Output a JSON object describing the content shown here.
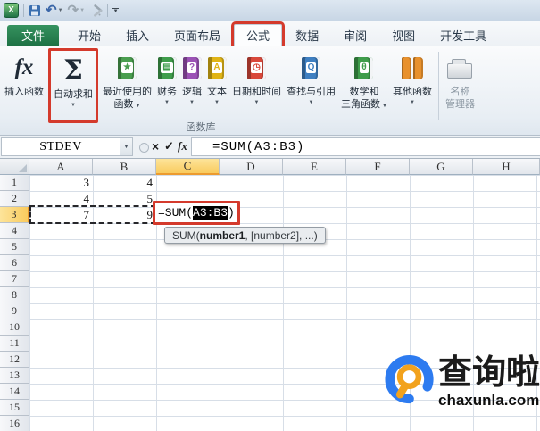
{
  "qat": {
    "icons": [
      "excel-logo",
      "save",
      "undo",
      "redo",
      "tools",
      "customize-quick-access-toolbar"
    ]
  },
  "tabs": {
    "file": {
      "id": "file",
      "label": "文件"
    },
    "items": [
      {
        "id": "home",
        "label": "开始"
      },
      {
        "id": "insert",
        "label": "插入"
      },
      {
        "id": "page-layout",
        "label": "页面布局"
      },
      {
        "id": "formulas",
        "label": "公式",
        "active": true,
        "annotated": true
      },
      {
        "id": "data",
        "label": "数据"
      },
      {
        "id": "review",
        "label": "审阅"
      },
      {
        "id": "view",
        "label": "视图"
      },
      {
        "id": "developer",
        "label": "开发工具"
      }
    ]
  },
  "ribbon": {
    "group_label": "函数库",
    "buttons": [
      {
        "id": "insert-function",
        "label_lines": [
          "插入函数"
        ],
        "icon": "fx",
        "has_caret": false
      },
      {
        "id": "autosum",
        "label_lines": [
          "自动求和"
        ],
        "icon": "sigma",
        "has_caret": true,
        "boxed": true
      },
      {
        "id": "recently-used-functions",
        "label_lines": [
          "最近使用的",
          "函数"
        ],
        "icon": "book",
        "glyph": "★",
        "color": "#4a9e4f",
        "has_caret": true
      },
      {
        "id": "financial",
        "label_lines": [
          "财务"
        ],
        "icon": "book",
        "glyph": "▤",
        "color": "#3f9d4b",
        "has_caret": true
      },
      {
        "id": "logical",
        "label_lines": [
          "逻辑"
        ],
        "icon": "book",
        "glyph": "?",
        "color": "#9b52b5",
        "has_caret": true
      },
      {
        "id": "text",
        "label_lines": [
          "文本"
        ],
        "icon": "book",
        "glyph": "A",
        "color": "#e0b416",
        "has_caret": true
      },
      {
        "id": "date-time",
        "label_lines": [
          "日期和时间"
        ],
        "icon": "book",
        "glyph": "◷",
        "color": "#d9483b",
        "has_caret": true
      },
      {
        "id": "lookup-reference",
        "label_lines": [
          "查找与引用"
        ],
        "icon": "book",
        "glyph": "Q",
        "color": "#3e7fc1",
        "has_caret": true
      },
      {
        "id": "math-trig",
        "label_lines": [
          "数学和",
          "三角函数"
        ],
        "icon": "book",
        "glyph": "θ",
        "color": "#3f9d4b",
        "has_caret": true
      },
      {
        "id": "more-functions",
        "label_lines": [
          "其他函数"
        ],
        "icon": "books",
        "color": "#e8912d",
        "has_caret": true
      },
      {
        "separator": true
      },
      {
        "id": "name-manager",
        "label_lines": [
          "名称",
          "管理器"
        ],
        "icon": "drawer",
        "has_caret": false,
        "disabled": true
      }
    ]
  },
  "formula_bar": {
    "name_box_value": "STDEV",
    "formula": "=SUM(A3:B3)"
  },
  "grid": {
    "columns": [
      "A",
      "B",
      "C",
      "D",
      "E",
      "F",
      "G",
      "H"
    ],
    "row_count": 16,
    "selected_column": "C",
    "selected_row": 3,
    "cells": [
      {
        "ref": "A1",
        "value": "3"
      },
      {
        "ref": "B1",
        "value": "4"
      },
      {
        "ref": "A2",
        "value": "4"
      },
      {
        "ref": "B2",
        "value": "5"
      },
      {
        "ref": "A3",
        "value": "7"
      },
      {
        "ref": "B3",
        "value": "9"
      }
    ],
    "edit_cell": {
      "ref": "C3",
      "prefix": "=SUM(",
      "selected_text": "A3:B3",
      "suffix": ")"
    },
    "tooltip": {
      "prefix": "SUM(",
      "bold": "number1",
      "suffix": ", [number2], ...)"
    }
  },
  "watermark": {
    "title": "查询啦",
    "domain": "chaxunla.com"
  },
  "colors": {
    "annotation_red": "#d43a2c",
    "selected_header_fill": "#f9cb5e",
    "file_tab_green": "#1f7245",
    "file_tab_green_light": "#36925f",
    "logo_blue": "#2d7bf0",
    "logo_orange": "#f2a21d"
  }
}
